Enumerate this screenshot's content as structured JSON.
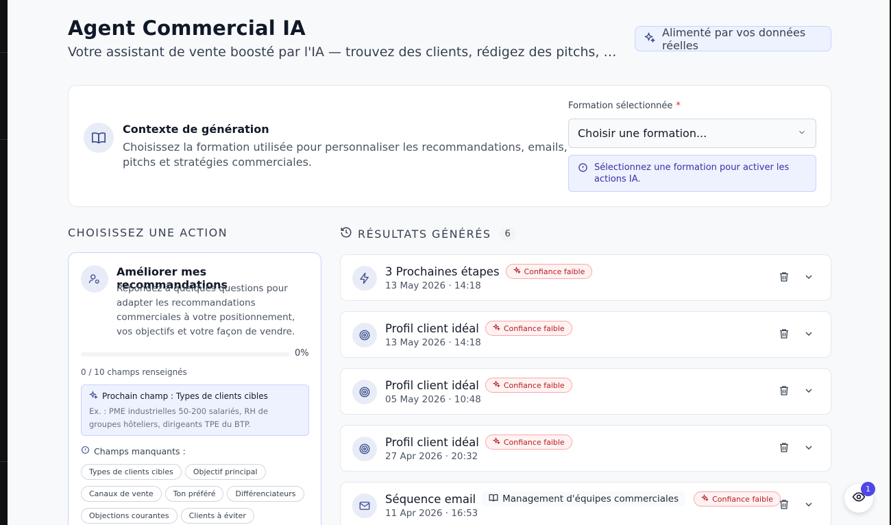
{
  "header": {
    "title": "Agent Commercial IA",
    "subtitle": "Votre assistant de vente boosté par l'IA — trouvez des clients, rédigez des pitchs, accélérez votre b…",
    "badge": "Alimenté par vos données réelles"
  },
  "context": {
    "title": "Contexte de génération",
    "description": "Choisissez la formation utilisée pour personnaliser les recommandations, emails, pitchs et stratégies commerciales.",
    "field_label": "Formation sélectionnée",
    "required_mark": "*",
    "select_value": "Choisir une formation...",
    "info": "Sélectionnez une formation pour activer les actions IA."
  },
  "actions_section": {
    "title": "CHOISISSEZ UNE ACTION"
  },
  "action_card": {
    "title": "Améliorer mes recommandations",
    "description": "Répondez à quelques questions pour adapter les recommandations commerciales à votre positionnement, vos objectifs et votre façon de vendre.",
    "progress_percent": 0,
    "progress_label": "0%",
    "filled_text": "0 / 10 champs renseignés",
    "next_field": "Prochain champ : Types de clients cibles",
    "next_example": "Ex. : PME industrielles 50-200 salariés, RH de groupes hôteliers, dirigeants TPE du BTP.",
    "missing_label": "Champs manquants :",
    "chips": [
      "Types de clients cibles",
      "Objectif principal",
      "Canaux de vente",
      "Ton préféré",
      "Différenciateurs",
      "Objections courantes",
      "Clients à éviter"
    ]
  },
  "results_section": {
    "title": "RÉSULTATS GÉNÉRÉS",
    "count": "6"
  },
  "results": [
    {
      "icon": "bolt-icon",
      "name": "3 Prochaines étapes",
      "confidence": "Confiance faible",
      "date": "13 May 2026 · 14:18",
      "tag": ""
    },
    {
      "icon": "target-icon",
      "name": "Profil client idéal",
      "confidence": "Confiance faible",
      "date": "13 May 2026 · 14:18",
      "tag": ""
    },
    {
      "icon": "target-icon",
      "name": "Profil client idéal",
      "confidence": "Confiance faible",
      "date": "05 May 2026 · 10:48",
      "tag": ""
    },
    {
      "icon": "target-icon",
      "name": "Profil client idéal",
      "confidence": "Confiance faible",
      "date": "27 Apr 2026 · 20:32",
      "tag": ""
    },
    {
      "icon": "mail-icon",
      "name": "Séquence email",
      "confidence": "Confiance faible",
      "date": "11 Apr 2026 · 16:53",
      "tag": "Management d'équipes commerciales"
    }
  ],
  "fab": {
    "count": "1"
  },
  "colors": {
    "accent": "#4f46e5",
    "danger": "#dc2626",
    "icon": "#3b4a8a"
  }
}
